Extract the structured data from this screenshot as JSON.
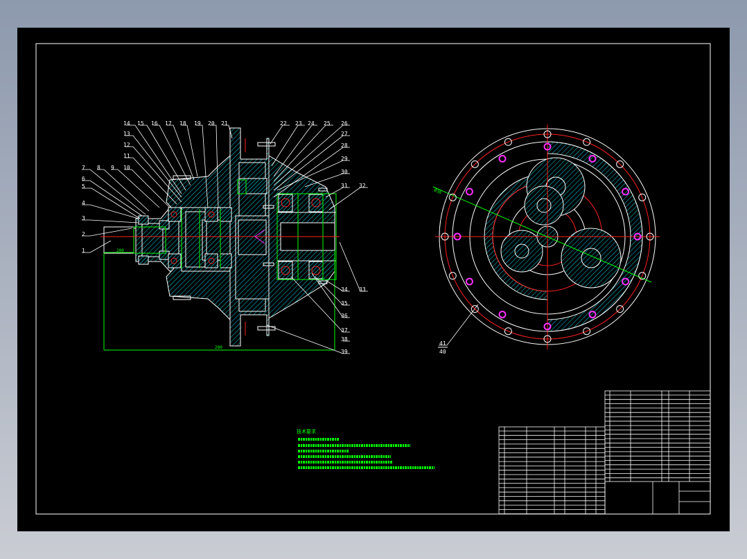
{
  "drawing": {
    "colors": {
      "background": "#000000",
      "outline": "#ffffff",
      "centerline": "#ff2020",
      "hatch": "#00d8e8",
      "dimension": "#00ff00",
      "bolt_holes": "#ff30ff"
    },
    "part_labels": [
      "1",
      "2",
      "3",
      "4",
      "5",
      "6",
      "7",
      "8",
      "9",
      "10",
      "11",
      "12",
      "13",
      "14",
      "15",
      "16",
      "17",
      "18",
      "19",
      "20",
      "21",
      "22",
      "23",
      "24",
      "25",
      "26",
      "27",
      "28",
      "29",
      "30",
      "31",
      "32",
      "33",
      "34",
      "35",
      "36",
      "37",
      "38",
      "39",
      "40",
      "41"
    ],
    "dimensions": {
      "input_shaft": "200",
      "overall_length": "280",
      "diameter": "Ø38"
    },
    "technical_requirements_heading": "技术要求"
  }
}
